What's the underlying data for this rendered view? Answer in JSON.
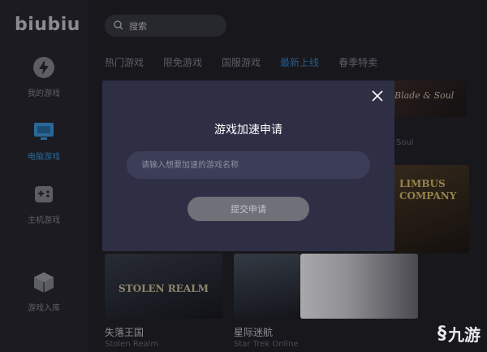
{
  "app": {
    "logo": "biubiu"
  },
  "sidebar": {
    "items": [
      {
        "label": "我的游戏",
        "icon": "lightning-icon",
        "active": false
      },
      {
        "label": "电脑游戏",
        "icon": "monitor-icon",
        "active": true
      },
      {
        "label": "主机游戏",
        "icon": "gamepad-icon",
        "active": false
      },
      {
        "label": "游戏入库",
        "icon": "box-icon",
        "active": false
      }
    ]
  },
  "search": {
    "label": "搜索"
  },
  "tabs": [
    {
      "label": "热门游戏",
      "active": false
    },
    {
      "label": "限免游戏",
      "active": false
    },
    {
      "label": "国服游戏",
      "active": false
    },
    {
      "label": "最新上线",
      "active": true
    },
    {
      "label": "春季特卖",
      "active": false
    }
  ],
  "games": [
    {
      "cover_text": "Blade & Soul",
      "subtitle": "Soul"
    },
    {
      "cover_text": "LIMBUS COMPANY"
    },
    {
      "title": "失落王国",
      "subtitle": "Stolen Realm",
      "cover_text": "STOLEN REALM"
    },
    {
      "title": "星际迷航",
      "subtitle": "Star Trek Online"
    }
  ],
  "modal": {
    "title": "游戏加速申请",
    "input_placeholder": "请输入想要加速的游戏名称",
    "submit_label": "提交申请"
  },
  "watermark": {
    "text": "九游"
  },
  "colors": {
    "accent": "#3d85c6",
    "modal_bg": "#2e2f45",
    "sidebar_bg": "#26262b"
  }
}
